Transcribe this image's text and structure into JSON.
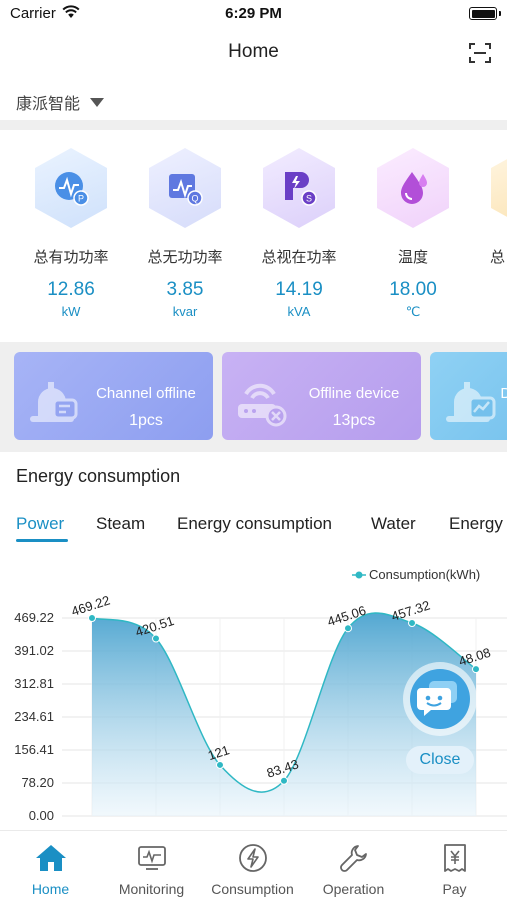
{
  "status_bar": {
    "carrier": "Carrier",
    "time": "6:29 PM"
  },
  "nav": {
    "title": "Home"
  },
  "company": {
    "name": "康派智能"
  },
  "metrics": [
    {
      "label": "总有功功率",
      "value": "12.86",
      "unit": "kW",
      "icon": "power-meter-p-icon",
      "color": "#5a9ee6"
    },
    {
      "label": "总无功功率",
      "value": "3.85",
      "unit": "kvar",
      "icon": "power-meter-q-icon",
      "color": "#6c85e6"
    },
    {
      "label": "总视在功率",
      "value": "14.19",
      "unit": "kVA",
      "icon": "power-s-icon",
      "color": "#7a5ad6"
    },
    {
      "label": "温度",
      "value": "18.00",
      "unit": "℃",
      "icon": "temperature-drop-icon",
      "color": "#b45ad6"
    },
    {
      "label": "总",
      "value": "",
      "unit": "",
      "icon": "partial-metric-icon",
      "color": "#f0b040"
    }
  ],
  "alert_cards": [
    {
      "title": "Channel offline",
      "count": "1pcs",
      "icon": "channel-offline-icon"
    },
    {
      "title": "Offline device",
      "count": "13pcs",
      "icon": "offline-device-icon"
    },
    {
      "title": "De",
      "count": "",
      "icon": "device-chart-icon"
    }
  ],
  "energy": {
    "section_title": "Energy consumption",
    "tabs": [
      "Power",
      "Steam",
      "Energy consumption",
      "Water",
      "Energy"
    ],
    "active_tab": 0
  },
  "chart_data": {
    "type": "area",
    "title": "",
    "xlabel": "",
    "ylabel": "",
    "legend": [
      "Consumption(kWh)"
    ],
    "legend_position": "top-right",
    "y_ticks": [
      "469.22",
      "391.02",
      "312.81",
      "234.61",
      "156.41",
      "78.20",
      "0.00"
    ],
    "ylim": [
      0,
      469.22
    ],
    "grid": true,
    "series": [
      {
        "name": "Consumption(kWh)",
        "values": [
          469.22,
          420.51,
          121,
          83.43,
          445.06,
          457.32,
          348.08
        ]
      }
    ],
    "point_labels": [
      "469.22",
      "420.51",
      "121",
      "83.43",
      "445.06",
      "457.32",
      "48.08"
    ],
    "color": "#2fb8c4"
  },
  "floating": {
    "close_label": "Close",
    "chat_icon": "chat-bubbles-icon"
  },
  "tabbar": {
    "items": [
      {
        "label": "Home",
        "icon": "home-icon"
      },
      {
        "label": "Monitoring",
        "icon": "monitor-icon"
      },
      {
        "label": "Consumption",
        "icon": "lightning-icon"
      },
      {
        "label": "Operation",
        "icon": "wrench-icon"
      },
      {
        "label": "Pay",
        "icon": "yen-bill-icon"
      }
    ],
    "active": 0
  }
}
